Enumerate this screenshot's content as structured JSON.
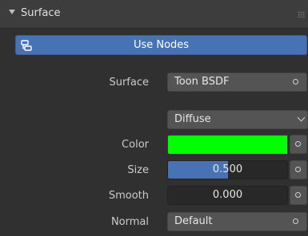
{
  "panel": {
    "title": "Surface",
    "collapse_icon": "triangle-down-icon",
    "drag_icon": "drag-handle-icon"
  },
  "use_nodes": {
    "label": "Use Nodes",
    "icon": "node-tree-icon",
    "accent": "#4772b3"
  },
  "surface": {
    "label": "Surface",
    "value": "Toon BSDF"
  },
  "component": {
    "value": "Diffuse"
  },
  "color": {
    "label": "Color",
    "hex": "#00ff00"
  },
  "size": {
    "label": "Size",
    "value": "0.500",
    "fraction": 0.5
  },
  "smooth": {
    "label": "Smooth",
    "value": "0.000",
    "fraction": 0.0
  },
  "normal": {
    "label": "Normal",
    "value": "Default"
  }
}
